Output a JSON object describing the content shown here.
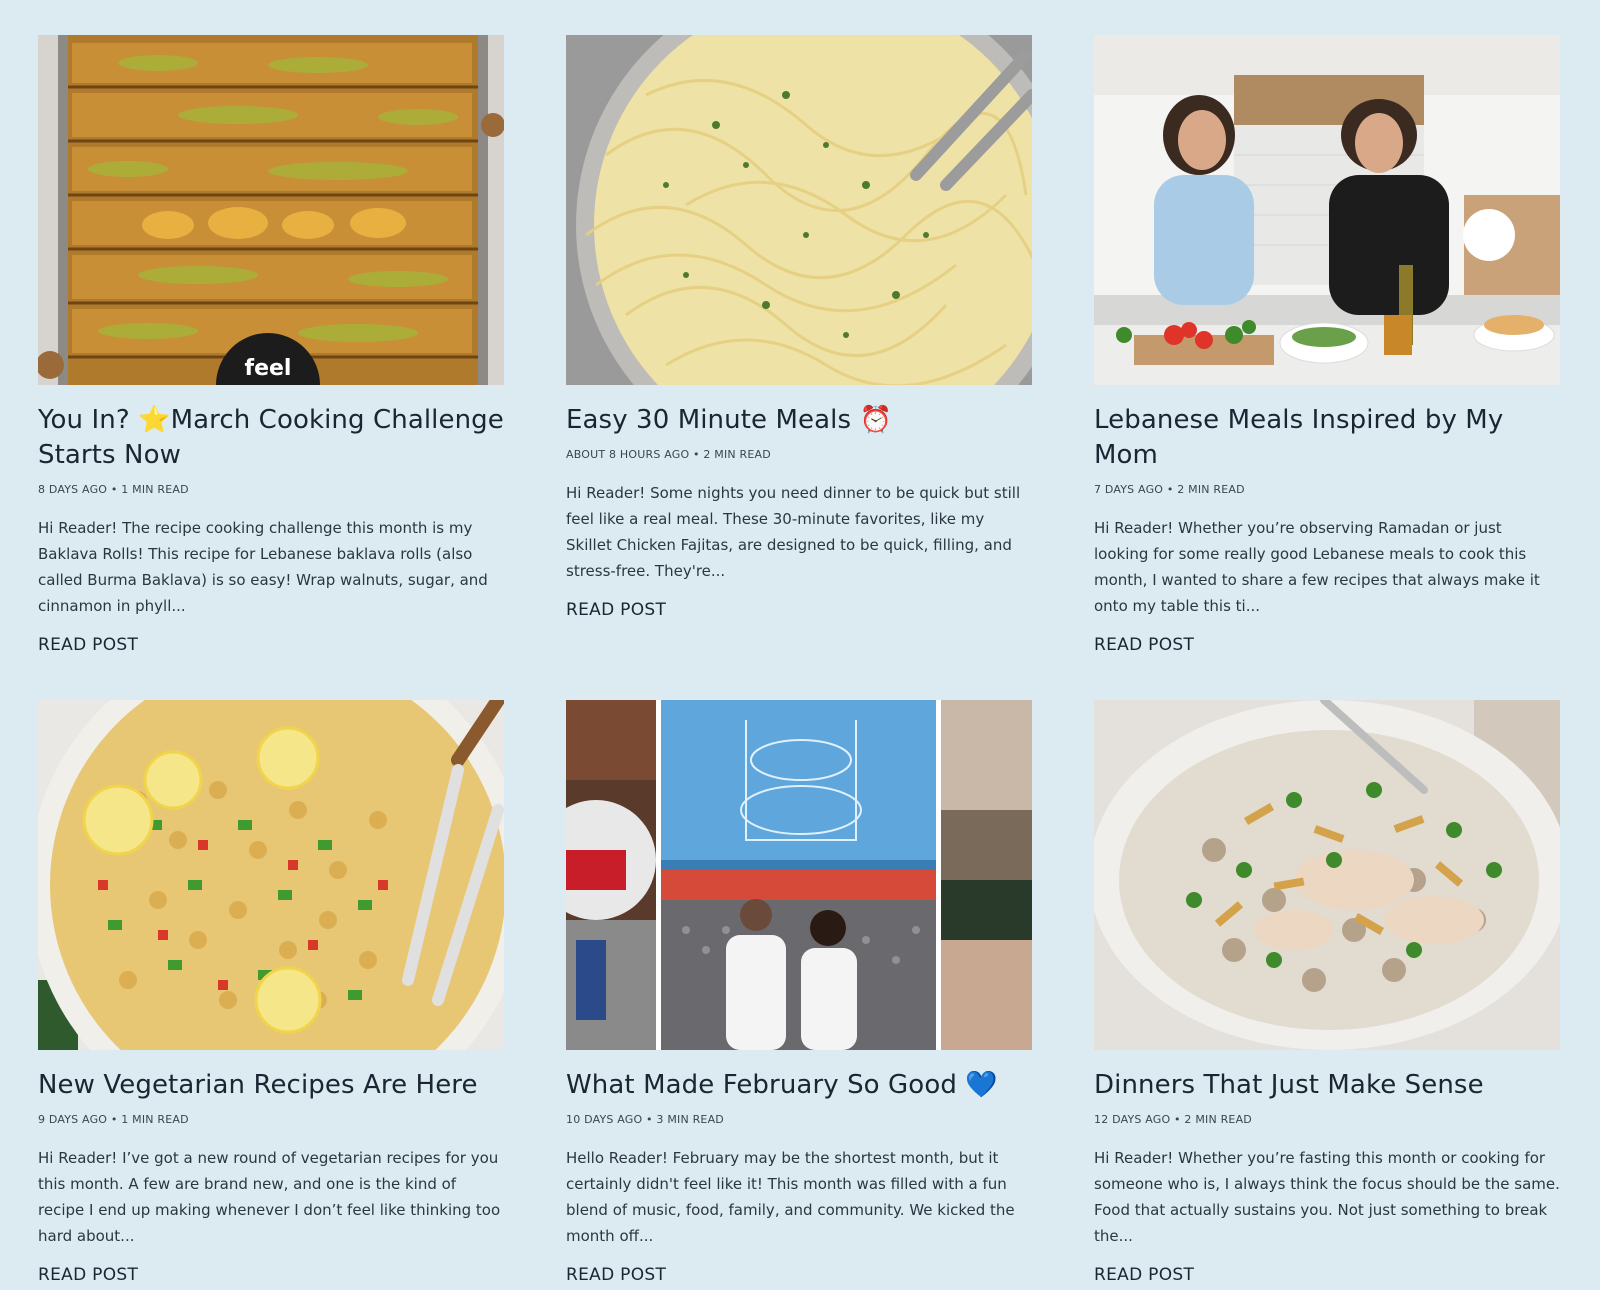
{
  "posts": [
    {
      "title": "You In? ⭐March Cooking Challenge Starts Now",
      "meta": "8 DAYS AGO • 1 MIN READ",
      "excerpt": "Hi Reader! The recipe cooking challenge this month is my Baklava Rolls! This recipe for Lebanese baklava rolls (also called Burma Baklava) is so easy! Wrap walnuts, sugar, and cinnamon in phyll...",
      "read": "READ POST",
      "image_alt": "Tray of baklava rolls topped with pistachios",
      "badge": "feel"
    },
    {
      "title": "Easy 30 Minute Meals ⏰",
      "meta": "ABOUT 8 HOURS AGO • 2 MIN READ",
      "excerpt": "Hi Reader! Some nights you need dinner to be quick but still feel like a real meal. These 30-minute favorites, like my Skillet Chicken Fajitas, are designed to be quick, filling, and stress-free. They're...",
      "read": "READ POST",
      "image_alt": "Creamy linguine pasta in a pan with parsley"
    },
    {
      "title": "Lebanese Meals Inspired by My Mom",
      "meta": "7 DAYS AGO • 2 MIN READ",
      "excerpt": "Hi Reader! Whether you’re observing Ramadan or just looking for some really good Lebanese meals to cook this month, I wanted to share a few recipes that always make it onto my table this ti...",
      "read": "READ POST",
      "image_alt": "Two women cooking in a white kitchen"
    },
    {
      "title": "New Vegetarian Recipes Are Here",
      "meta": "9 DAYS AGO • 1 MIN READ",
      "excerpt": "Hi Reader! I’ve got a new round of vegetarian recipes for you this month. A few are brand new, and one is the kind of recipe I end up making whenever I don’t feel like thinking too hard about...",
      "read": "READ POST",
      "image_alt": "Chickpea salad with lemon slices and serving forks"
    },
    {
      "title": "What Made February So Good 💙",
      "meta": "10 DAYS AGO • 3 MIN READ",
      "excerpt": "Hello Reader! February may be the shortest month, but it certainly didn't feel like it! This month was filled with a fun blend of music, food, family, and community. We kicked the month off...",
      "read": "READ POST",
      "image_alt": "Collage of Las Vegas photos and a couple at a concert"
    },
    {
      "title": "Dinners That Just Make Sense",
      "meta": "12 DAYS AGO • 2 MIN READ",
      "excerpt": "Hi Reader! Whether you’re fasting this month or cooking for someone who is, I always think the focus should be the same. Food that actually sustains you. Not just something to break the...",
      "read": "READ POST",
      "image_alt": "Bowl of rice with chicken, toasted almonds and parsley"
    }
  ]
}
